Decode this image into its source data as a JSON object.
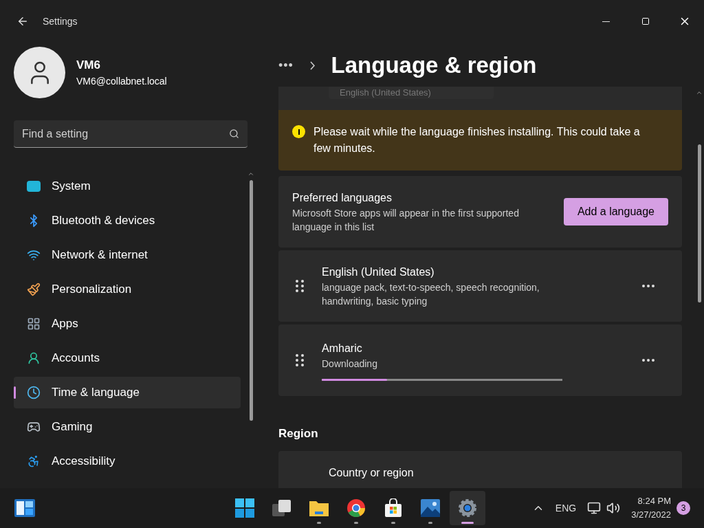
{
  "window": {
    "title": "Settings"
  },
  "profile": {
    "name": "VM6",
    "email": "VM6@collabnet.local"
  },
  "search": {
    "placeholder": "Find a setting"
  },
  "nav": [
    {
      "label": "System",
      "selected": false
    },
    {
      "label": "Bluetooth & devices",
      "selected": false
    },
    {
      "label": "Network & internet",
      "selected": false
    },
    {
      "label": "Personalization",
      "selected": false
    },
    {
      "label": "Apps",
      "selected": false
    },
    {
      "label": "Accounts",
      "selected": false
    },
    {
      "label": "Time & language",
      "selected": true
    },
    {
      "label": "Gaming",
      "selected": false
    },
    {
      "label": "Accessibility",
      "selected": false
    }
  ],
  "breadcrumb": {
    "more": "•••",
    "title": "Language & region"
  },
  "display_language_value": "English (United States)",
  "warning": "Please wait while the language finishes installing. This could take a few minutes.",
  "preferred": {
    "title": "Preferred languages",
    "description": "Microsoft Store apps will appear in the first supported language in this list",
    "button": "Add a language"
  },
  "languages": [
    {
      "kind": "installed",
      "name": "English (United States)",
      "detail": "language pack, text-to-speech, speech recognition, handwriting, basic typing"
    },
    {
      "kind": "downloading",
      "name": "Amharic",
      "detail": "Downloading",
      "level": 0.27
    }
  ],
  "region": {
    "heading": "Region",
    "items": [
      {
        "label": "Country or region"
      }
    ]
  },
  "taskbar": {
    "apps": [
      {
        "running": false,
        "selected": false
      },
      {
        "running": false,
        "selected": false
      },
      {
        "running": true,
        "selected": false
      },
      {
        "running": true,
        "selected": false
      },
      {
        "running": true,
        "selected": false
      },
      {
        "running": true,
        "selected": false
      },
      {
        "running": true,
        "selected": true
      }
    ],
    "language": "ENG",
    "time": "8:24 PM",
    "date": "3/27/2022",
    "notifications": "3"
  }
}
